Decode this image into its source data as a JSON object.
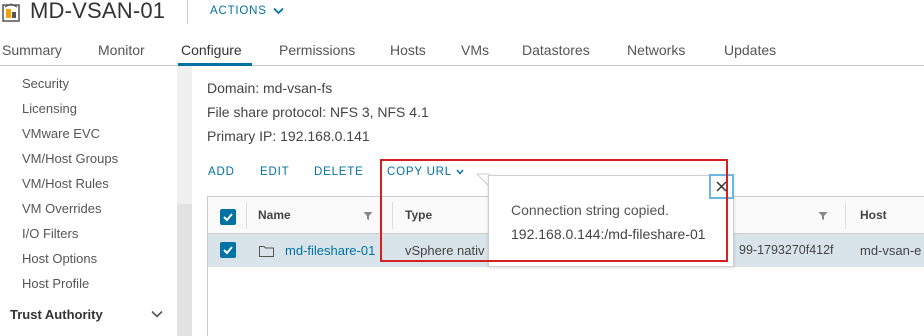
{
  "header": {
    "title": "MD-VSAN-01",
    "actions_label": "ACTIONS"
  },
  "tabs": [
    {
      "label": "Summary"
    },
    {
      "label": "Monitor"
    },
    {
      "label": "Configure",
      "active": true
    },
    {
      "label": "Permissions"
    },
    {
      "label": "Hosts"
    },
    {
      "label": "VMs"
    },
    {
      "label": "Datastores"
    },
    {
      "label": "Networks"
    },
    {
      "label": "Updates"
    }
  ],
  "sidebar": {
    "items": [
      {
        "label": "Security"
      },
      {
        "label": "Licensing"
      },
      {
        "label": "VMware EVC"
      },
      {
        "label": "VM/Host Groups"
      },
      {
        "label": "VM/Host Rules"
      },
      {
        "label": "VM Overrides"
      },
      {
        "label": "I/O Filters"
      },
      {
        "label": "Host Options"
      },
      {
        "label": "Host Profile"
      }
    ],
    "section": {
      "label": "Trust Authority"
    }
  },
  "info": {
    "domain": "Domain: md-vsan-fs",
    "protocol": "File share protocol: NFS 3, NFS 4.1",
    "primary_ip": "Primary IP: 192.168.0.141"
  },
  "toolbar": {
    "add": "ADD",
    "edit": "EDIT",
    "delete": "DELETE",
    "copy_url": "COPY URL"
  },
  "grid": {
    "columns": [
      {
        "label": "Name"
      },
      {
        "label": "Type"
      },
      {
        "label": "Host"
      }
    ],
    "rows": [
      {
        "name": "md-fileshare-01",
        "type": "vSphere nativ",
        "uuid_fragment": "99-1793270f412f",
        "host": "md-vsan-e",
        "selected": true
      }
    ]
  },
  "popover": {
    "message": "Connection string copied.",
    "url": "192.168.0.144:/md-fileshare-01"
  },
  "colors": {
    "accent": "#0072a3",
    "annotation": "#d62020",
    "selected_row": "#d9e4ea"
  }
}
